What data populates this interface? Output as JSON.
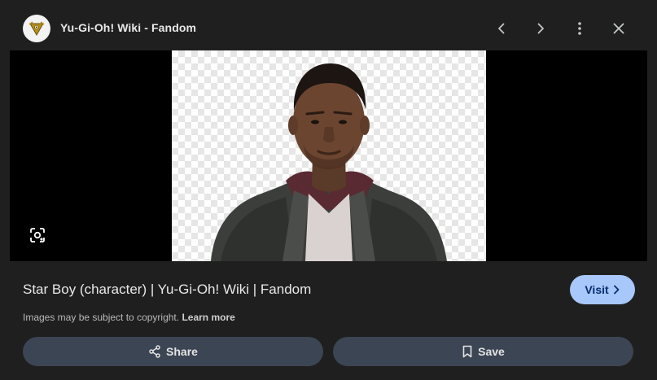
{
  "header": {
    "site_name": "Yu-Gi-Oh! Wiki - Fandom",
    "logo_icon": "millennium-puzzle-logo-icon",
    "prev_icon": "chevron-left-icon",
    "next_icon": "chevron-right-icon",
    "more_icon": "more-vert-icon",
    "close_icon": "close-icon"
  },
  "viewer": {
    "lens_icon": "lens-search-icon"
  },
  "result": {
    "title": "Star Boy (character) | Yu-Gi-Oh! Wiki | Fandom",
    "visit_label": "Visit",
    "copyright_text": "Images may be subject to copyright.",
    "learn_more_label": "Learn more"
  },
  "actions": {
    "share_label": "Share",
    "share_icon": "share-icon",
    "save_label": "Save",
    "save_icon": "bookmark-icon"
  },
  "colors": {
    "panel_bg": "#1f1f1f",
    "visit_bg": "#a8c7fa",
    "action_bg": "#3c4553"
  }
}
